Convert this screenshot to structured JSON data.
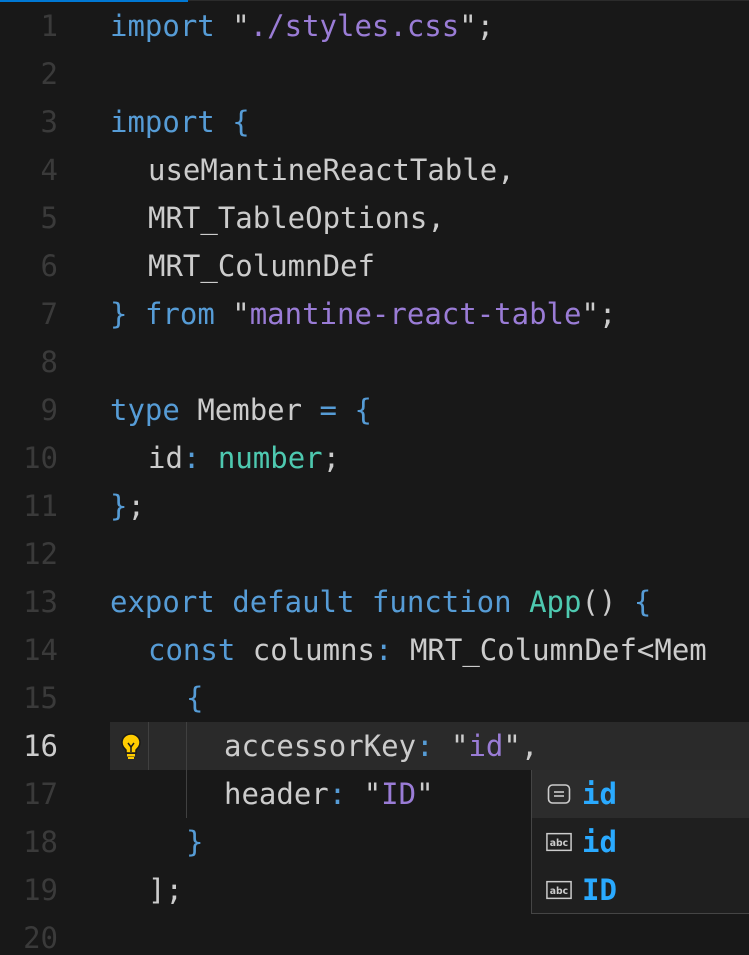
{
  "editor": {
    "active_line": "16",
    "lines": [
      {
        "num": "1"
      },
      {
        "num": "2"
      },
      {
        "num": "3"
      },
      {
        "num": "4"
      },
      {
        "num": "5"
      },
      {
        "num": "6"
      },
      {
        "num": "7"
      },
      {
        "num": "8"
      },
      {
        "num": "9"
      },
      {
        "num": "10"
      },
      {
        "num": "11"
      },
      {
        "num": "12"
      },
      {
        "num": "13"
      },
      {
        "num": "14"
      },
      {
        "num": "15"
      },
      {
        "num": "16"
      },
      {
        "num": "17"
      },
      {
        "num": "18"
      },
      {
        "num": "19"
      },
      {
        "num": "20"
      }
    ],
    "code": {
      "l1_import": "import",
      "l1_str": "./styles.css",
      "l3_import": "import",
      "l4_text": "useMantineReactTable,",
      "l5_text": "MRT_TableOptions,",
      "l6_text": "MRT_ColumnDef",
      "l7_from": "from",
      "l7_str": "mantine-react-table",
      "l9_type": "type",
      "l9_name": "Member",
      "l10_prop": "id",
      "l10_type": "number",
      "l13_export": "export",
      "l13_default": "default",
      "l13_function": "function",
      "l13_name": "App",
      "l14_const": "const",
      "l14_var": "columns",
      "l14_type": "MRT_ColumnDef<Mem",
      "l16_prop": "accessorKey",
      "l16_str": "id",
      "l17_prop": "header",
      "l17_str": "ID"
    }
  },
  "suggestions": [
    {
      "label": "id",
      "icon": "field-icon"
    },
    {
      "label": "id",
      "icon": "text-abc-icon"
    },
    {
      "label": "ID",
      "icon": "text-abc-icon"
    }
  ],
  "colors": {
    "background": "#181818",
    "keyword": "#569cd6",
    "string": "#9a7cd6",
    "type": "#4ec9b0",
    "suggestion_text": "#2aaaff",
    "lightbulb": "#ffcc00"
  }
}
